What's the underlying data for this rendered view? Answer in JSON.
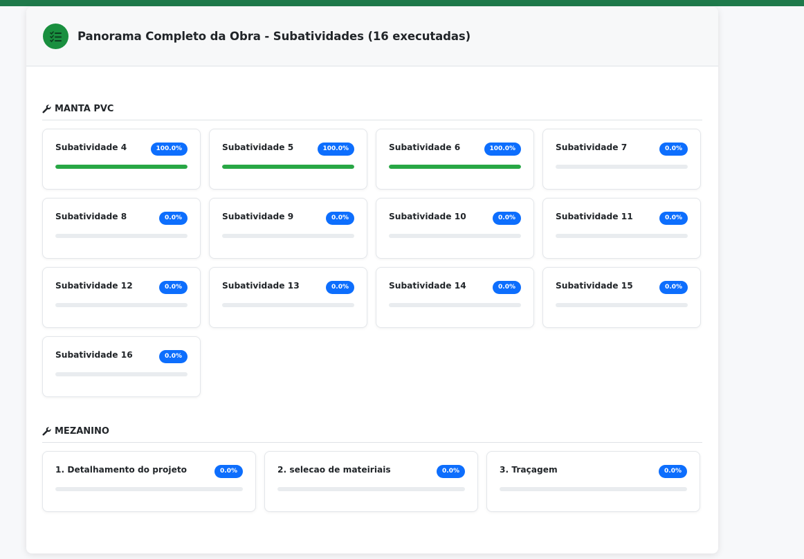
{
  "header": {
    "title": "Panorama Completo da Obra - Subatividades (16 executadas)",
    "icon": "list-check-icon",
    "accent": "#198f3f"
  },
  "sections": [
    {
      "title": "MANTA PVC",
      "icon": "wrench-icon",
      "items": [
        {
          "name": "Subatividade 4",
          "percent_label": "100.0%",
          "progress": 100
        },
        {
          "name": "Subatividade 5",
          "percent_label": "100.0%",
          "progress": 100
        },
        {
          "name": "Subatividade 6",
          "percent_label": "100.0%",
          "progress": 100
        },
        {
          "name": "Subatividade 7",
          "percent_label": "0.0%",
          "progress": 0
        },
        {
          "name": "Subatividade 8",
          "percent_label": "0.0%",
          "progress": 0
        },
        {
          "name": "Subatividade 9",
          "percent_label": "0.0%",
          "progress": 0
        },
        {
          "name": "Subatividade 10",
          "percent_label": "0.0%",
          "progress": 0
        },
        {
          "name": "Subatividade 11",
          "percent_label": "0.0%",
          "progress": 0
        },
        {
          "name": "Subatividade 12",
          "percent_label": "0.0%",
          "progress": 0
        },
        {
          "name": "Subatividade 13",
          "percent_label": "0.0%",
          "progress": 0
        },
        {
          "name": "Subatividade 14",
          "percent_label": "0.0%",
          "progress": 0
        },
        {
          "name": "Subatividade 15",
          "percent_label": "0.0%",
          "progress": 0
        },
        {
          "name": "Subatividade 16",
          "percent_label": "0.0%",
          "progress": 0
        }
      ]
    },
    {
      "title": "MEZANINO",
      "icon": "wrench-icon",
      "items": [
        {
          "name": "1. Detalhamento do projeto",
          "percent_label": "0.0%",
          "progress": 0
        },
        {
          "name": "2. selecao de mateiriais",
          "percent_label": "0.0%",
          "progress": 0
        },
        {
          "name": "3. Traçagem",
          "percent_label": "0.0%",
          "progress": 0
        }
      ]
    }
  ],
  "colors": {
    "badge": "#0d6efd",
    "progress_fill": "#28a745",
    "progress_track": "#e9ecef",
    "top_bar": "#1f7a4b"
  }
}
